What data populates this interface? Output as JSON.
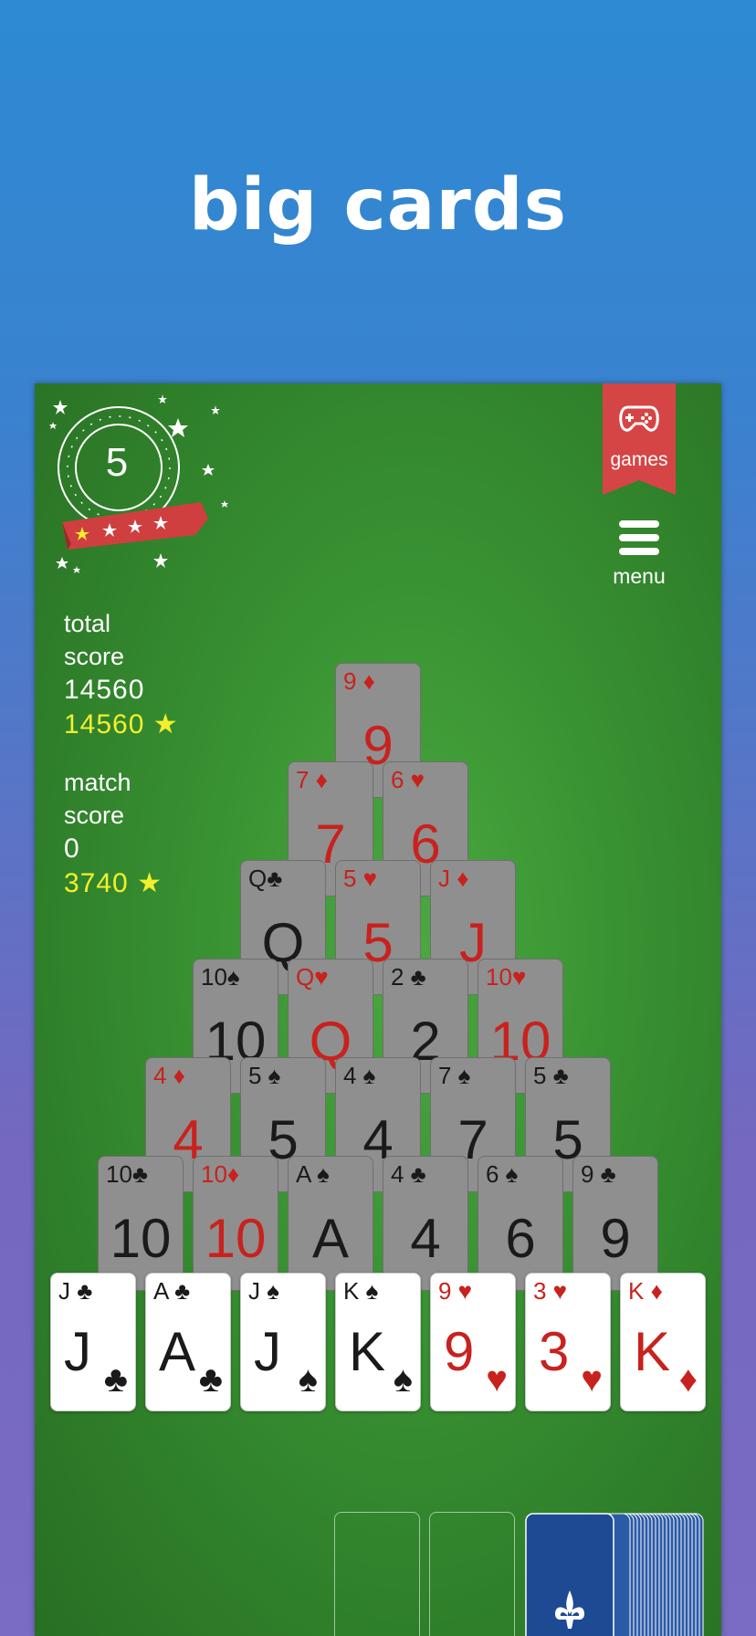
{
  "headline": "big cards",
  "level": "5",
  "total_score_label_1": "total",
  "total_score_label_2": "score",
  "total_score": "14560",
  "total_score_best": "14560 ★",
  "match_score_label_1": "match",
  "match_score_label_2": "score",
  "match_score": "0",
  "match_score_best": "3740 ★",
  "games_label": "games",
  "menu_label": "menu",
  "colors": {
    "red": "#c8221e",
    "felt": "#3a9433",
    "ribbon": "#d64545",
    "card_back": "#1d4a93"
  },
  "pyramid": {
    "row1": [
      {
        "rank": "9",
        "suit": "♦",
        "corner": "9 ♦",
        "color": "red"
      }
    ],
    "row2": [
      {
        "rank": "7",
        "suit": "♦",
        "corner": "7 ♦",
        "color": "red"
      },
      {
        "rank": "6",
        "suit": "♥",
        "corner": "6 ♥",
        "color": "red"
      }
    ],
    "row3": [
      {
        "rank": "Q",
        "suit": "♣",
        "corner": "Q♣",
        "color": "blk"
      },
      {
        "rank": "5",
        "suit": "♥",
        "corner": "5 ♥",
        "color": "red"
      },
      {
        "rank": "J",
        "suit": "♦",
        "corner": "J ♦",
        "color": "red"
      }
    ],
    "row4": [
      {
        "rank": "10",
        "suit": "♠",
        "corner": "10♠",
        "color": "blk"
      },
      {
        "rank": "Q",
        "suit": "♥",
        "corner": "Q♥",
        "color": "red"
      },
      {
        "rank": "2",
        "suit": "♣",
        "corner": "2 ♣",
        "color": "blk"
      },
      {
        "rank": "10",
        "suit": "♥",
        "corner": "10♥",
        "color": "red"
      }
    ],
    "row5": [
      {
        "rank": "4",
        "suit": "♦",
        "corner": "4 ♦",
        "color": "red"
      },
      {
        "rank": "5",
        "suit": "♠",
        "corner": "5 ♠",
        "color": "blk"
      },
      {
        "rank": "4",
        "suit": "♠",
        "corner": "4 ♠",
        "color": "blk"
      },
      {
        "rank": "7",
        "suit": "♠",
        "corner": "7 ♠",
        "color": "blk"
      },
      {
        "rank": "5",
        "suit": "♣",
        "corner": "5 ♣",
        "color": "blk"
      }
    ],
    "row6": [
      {
        "rank": "10",
        "suit": "♣",
        "corner": "10♣",
        "color": "blk"
      },
      {
        "rank": "10",
        "suit": "♦",
        "corner": "10♦",
        "color": "red"
      },
      {
        "rank": "A",
        "suit": "♠",
        "corner": "A ♠",
        "color": "blk"
      },
      {
        "rank": "4",
        "suit": "♣",
        "corner": "4 ♣",
        "color": "blk"
      },
      {
        "rank": "6",
        "suit": "♠",
        "corner": "6 ♠",
        "color": "blk"
      },
      {
        "rank": "9",
        "suit": "♣",
        "corner": "9 ♣",
        "color": "blk"
      }
    ]
  },
  "bottom_row": [
    {
      "rank": "J",
      "suit": "♣",
      "corner": "J ♣",
      "color": "blk"
    },
    {
      "rank": "A",
      "suit": "♣",
      "corner": "A ♣",
      "color": "blk"
    },
    {
      "rank": "J",
      "suit": "♠",
      "corner": "J ♠",
      "color": "blk"
    },
    {
      "rank": "K",
      "suit": "♠",
      "corner": "K ♠",
      "color": "blk"
    },
    {
      "rank": "9",
      "suit": "♥",
      "corner": "9 ♥",
      "color": "red"
    },
    {
      "rank": "3",
      "suit": "♥",
      "corner": "3 ♥",
      "color": "red"
    },
    {
      "rank": "K",
      "suit": "♦",
      "corner": "K ♦",
      "color": "red"
    }
  ],
  "stock_icon": "fleur-de-lis-icon"
}
